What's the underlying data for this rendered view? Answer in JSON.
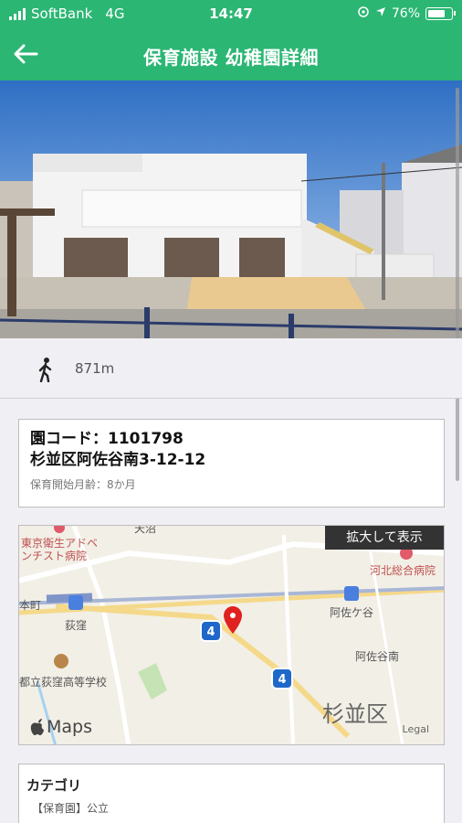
{
  "status_bar": {
    "carrier": "SoftBank",
    "network": "4G",
    "time": "14:47",
    "battery_percent": "76%",
    "battery_level": 0.76
  },
  "nav": {
    "title": "保育施設 幼稚園詳細",
    "back_icon": "arrow-left-icon"
  },
  "distance": {
    "icon": "walking-person-icon",
    "value": "871m"
  },
  "facility": {
    "code_line": "園コード：1101798",
    "address": "杉並区阿佐谷南3-12-12",
    "start_age_note": "保育開始月齢：8か月"
  },
  "map": {
    "zoom_label": "拡大して表示",
    "maps_label": "Maps",
    "legal_label": "Legal",
    "labels": {
      "hospital1": "東京衛生アドベ",
      "hospital1b": "ンチスト病院",
      "hospital2": "河北総合病院",
      "station1": "荻窪",
      "station2": "阿佐ケ谷",
      "area1": "阿佐谷南",
      "school": "都立荻窪高等学校",
      "ward": "杉並区",
      "place_top": "天沼",
      "place_left": "本町"
    },
    "route_numbers": [
      "4",
      "4"
    ]
  },
  "category": {
    "title": "カテゴリ",
    "value": "【保育園】公立"
  }
}
